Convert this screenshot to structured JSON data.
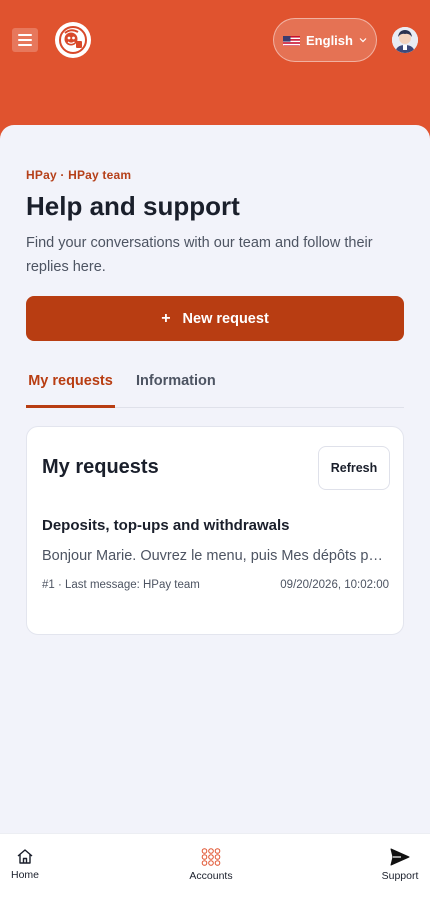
{
  "header": {
    "language_label": "English",
    "colors": {
      "brand": "#e0532f",
      "accent": "#b83d12"
    }
  },
  "page": {
    "eyebrow": "HPay · HPay team",
    "title": "Help and support",
    "subtitle": "Find your conversations with our team and follow their replies here.",
    "new_request_label": "New request"
  },
  "tabs": [
    {
      "label": "My requests",
      "active": true
    },
    {
      "label": "Information",
      "active": false
    }
  ],
  "requests_card": {
    "title": "My requests",
    "refresh_label": "Refresh",
    "items": [
      {
        "title": "Deposits, top-ups and withdrawals",
        "preview": "Bonjour Marie. Ouvrez le menu, puis Mes dépôts pour suivre vos opérations.",
        "meta": "#1 · Last message: HPay team",
        "date": "09/20/2026, 10:02:00"
      }
    ]
  },
  "bottom_nav": [
    {
      "label": "Home",
      "icon": "home-icon"
    },
    {
      "label": "Accounts",
      "icon": "grid-icon"
    },
    {
      "label": "Support",
      "icon": "send-icon"
    }
  ]
}
